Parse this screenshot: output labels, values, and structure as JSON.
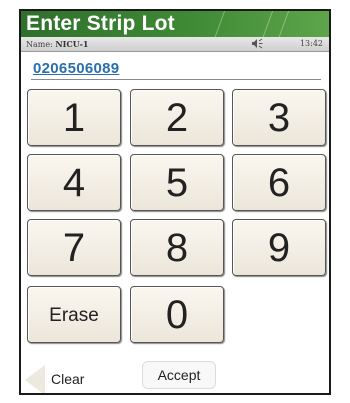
{
  "header": {
    "title": "Enter Strip Lot"
  },
  "status": {
    "name_label": "Name:",
    "name_value": "NICU-1",
    "time": "13:42",
    "speaker_icon": "speaker-icon"
  },
  "lot": {
    "value": "0206506089"
  },
  "keypad": {
    "k1": "1",
    "k2": "2",
    "k3": "3",
    "k4": "4",
    "k5": "5",
    "k6": "6",
    "k7": "7",
    "k8": "8",
    "k9": "9",
    "erase": "Erase",
    "k0": "0"
  },
  "footer": {
    "clear_label": "Clear",
    "accept_label": "Accept",
    "clear_icon": "left-arrow-icon"
  },
  "colors": {
    "title_green": "#3f8a35",
    "lot_blue": "#2a6fae",
    "key_face": "#f4efe5"
  }
}
